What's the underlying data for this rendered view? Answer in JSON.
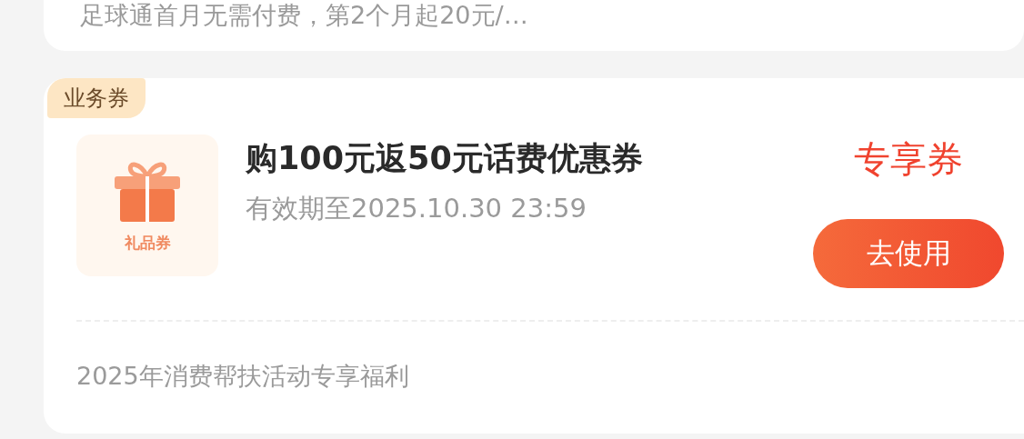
{
  "top_card": {
    "description": "足球通首月无需付费，第2个月起20元/…"
  },
  "coupon": {
    "tag": "业务券",
    "icon_label": "礼品券",
    "title": "购100元返50元话费优惠券",
    "validity": "有效期至2025.10.30 23:59",
    "badge": "专享券",
    "button": "去使用",
    "footer": "2025年消费帮扶活动专享福利"
  }
}
